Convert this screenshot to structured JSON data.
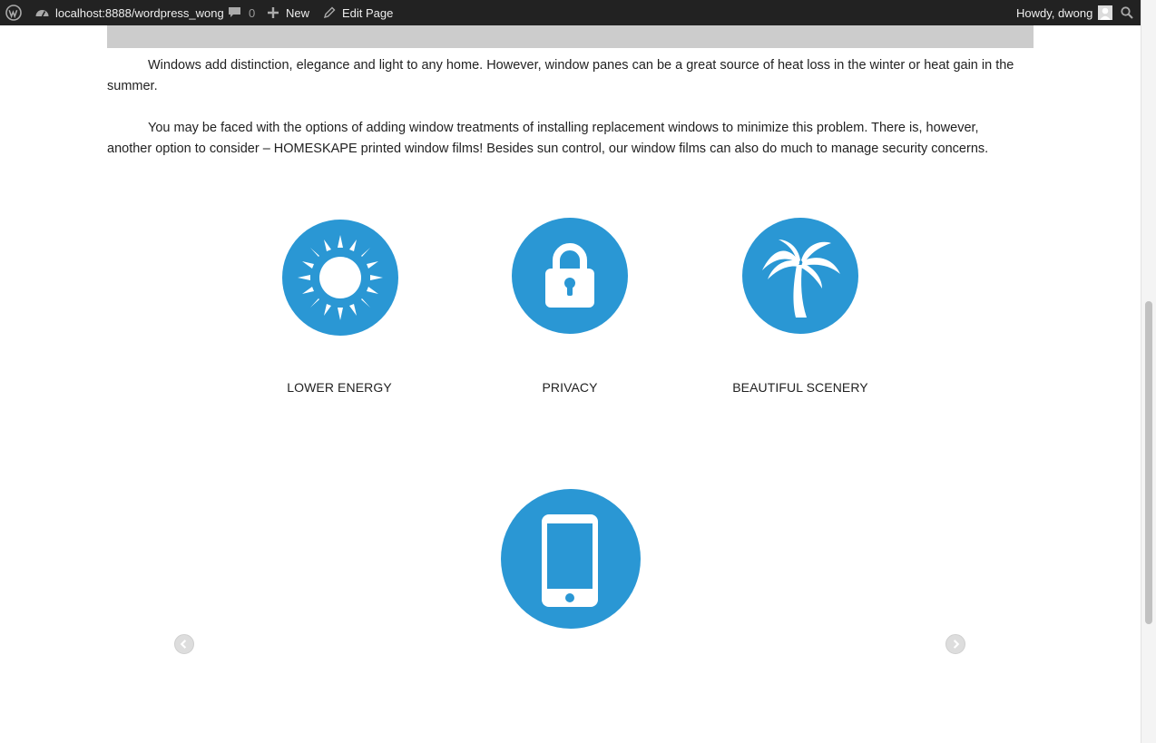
{
  "admin_bar": {
    "site_url": "localhost:8888/wordpress_wong",
    "comments_count": "0",
    "new_label": "New",
    "edit_page_label": "Edit Page",
    "greeting": "Howdy, dwong"
  },
  "content": {
    "paragraphs": [
      "Windows add distinction, elegance and light to any home. However, window panes can be a great source of heat loss in the winter or heat gain in the summer.",
      "You may be faced with the options of adding window treatments of installing replacement windows to minimize this problem. There is, however, another option to consider – HOMESKAPE printed window films! Besides sun control, our window films can also do much to manage security concerns."
    ],
    "features": [
      {
        "label": "LOWER ENERGY",
        "icon": "sun-icon"
      },
      {
        "label": "PRIVACY",
        "icon": "lock-icon"
      },
      {
        "label": "BEAUTIFUL SCENERY",
        "icon": "palm-tree-icon"
      },
      {
        "label": "",
        "icon": "smartphone-icon"
      }
    ]
  },
  "colors": {
    "accent": "#2a97d4",
    "admin_bar": "#222222",
    "banner": "#cccccc"
  }
}
